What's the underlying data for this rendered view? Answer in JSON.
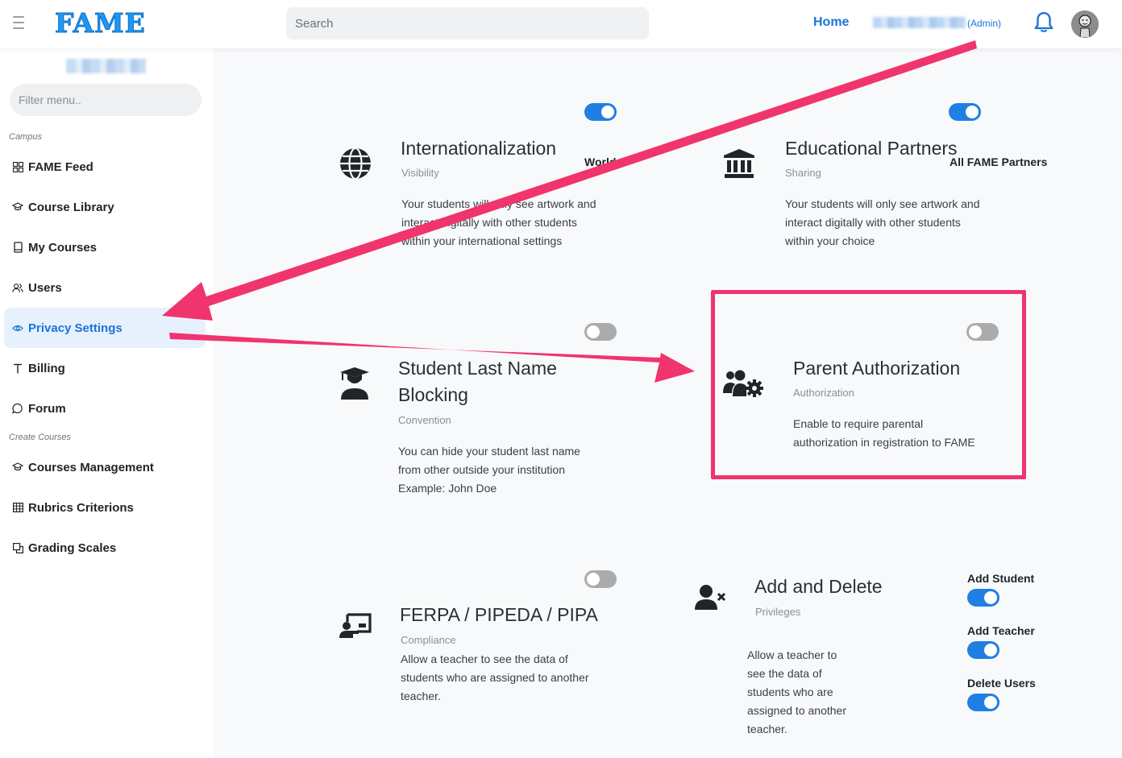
{
  "header": {
    "logo": "FAME",
    "search_placeholder": "Search",
    "home_link": "Home",
    "user_role": "(Admin)"
  },
  "sidebar": {
    "filter_placeholder": "Filter menu..",
    "sections": [
      {
        "label": "Campus"
      },
      {
        "label": "Create Courses"
      }
    ],
    "items": [
      {
        "label": "FAME Feed",
        "icon": "grid-icon"
      },
      {
        "label": "Course Library",
        "icon": "graduation-cap-icon"
      },
      {
        "label": "My Courses",
        "icon": "book-icon"
      },
      {
        "label": "Users",
        "icon": "users-icon"
      },
      {
        "label": "Privacy Settings",
        "icon": "eye-icon",
        "active": true
      },
      {
        "label": "Billing",
        "icon": "text-icon"
      },
      {
        "label": "Forum",
        "icon": "chat-icon"
      },
      {
        "label": "Courses Management",
        "icon": "graduation-cap-icon"
      },
      {
        "label": "Rubrics Criterions",
        "icon": "table-icon"
      },
      {
        "label": "Grading Scales",
        "icon": "copy-icon"
      }
    ]
  },
  "cards": {
    "internationalization": {
      "title": "Internationalization",
      "subtitle": "Visibility",
      "description_lines": [
        "Your students will only see artwork and",
        "interact digitally with other students",
        "within your international settings"
      ],
      "toggle_label": "World",
      "toggle_on": true
    },
    "educational_partners": {
      "title": "Educational Partners",
      "subtitle": "Sharing",
      "description_lines": [
        "Your students will only see artwork and",
        "interact digitally with other students",
        "within your choice"
      ],
      "toggle_label": "All FAME Partners",
      "toggle_on": true
    },
    "student_last_name": {
      "title_lines": [
        "Student Last Name",
        "Blocking"
      ],
      "subtitle": "Convention",
      "description_lines": [
        "You can hide your student last name",
        "from other outside your institution",
        "Example: John Doe"
      ],
      "toggle_on": false
    },
    "parent_authorization": {
      "title": "Parent Authorization",
      "subtitle": "Authorization",
      "description_lines": [
        "Enable to require parental",
        "authorization in registration to FAME"
      ],
      "toggle_on": false
    },
    "ferpa": {
      "title": "FERPA / PIPEDA / PIPA",
      "subtitle": "Compliance",
      "description_lines": [
        "Allow a teacher to see the data of",
        "students who are assigned to another",
        "teacher."
      ],
      "toggle_on": false
    },
    "add_delete": {
      "title": "Add and Delete",
      "subtitle": "Privileges",
      "description_lines": [
        "Allow a teacher to",
        "see the data of",
        "students who are",
        "assigned to another",
        "teacher."
      ],
      "toggles": [
        {
          "label": "Add Student",
          "on": true
        },
        {
          "label": "Add Teacher",
          "on": true
        },
        {
          "label": "Delete Users",
          "on": true
        }
      ]
    }
  },
  "colors": {
    "accent": "#1a73d9",
    "toggle_on": "#1f7fe5",
    "annotation": "#f0346e"
  }
}
